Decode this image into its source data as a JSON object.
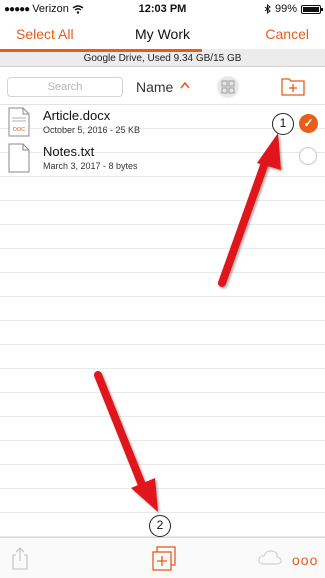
{
  "status_bar": {
    "carrier": "Verizon",
    "time": "12:03 PM",
    "battery": "99%"
  },
  "nav": {
    "left_action": "Select All",
    "title": "My Work",
    "right_action": "Cancel"
  },
  "storage": {
    "text": "Google Drive, Used 9.34 GB/15 GB",
    "used_fraction": 0.62
  },
  "toolbar": {
    "search_placeholder": "Search",
    "sort_label": "Name",
    "sort_caret": "^"
  },
  "files": [
    {
      "name": "Article.docx",
      "meta": "October 5, 2016 - 25 KB",
      "icon": "doc-file-icon",
      "icon_label": "DOC",
      "selected": true
    },
    {
      "name": "Notes.txt",
      "meta": "March 3, 2017 - 8 bytes",
      "icon": "text-file-icon",
      "selected": false
    }
  ],
  "callouts": [
    "1",
    "2"
  ],
  "bottom_bar": {
    "more_label": "ooo"
  },
  "colors": {
    "accent": "#e85c1c",
    "arrow": "#e0161b"
  }
}
